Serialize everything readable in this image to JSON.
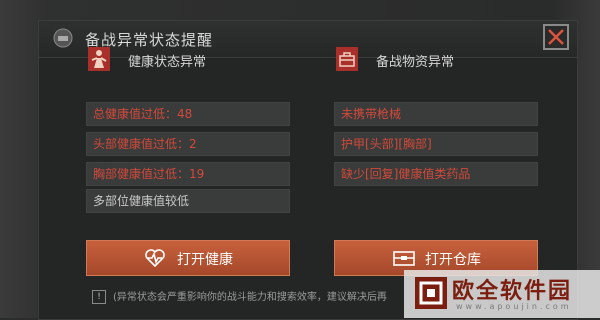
{
  "dialog": {
    "title": "备战异常状态提醒",
    "close_icon": "close-icon"
  },
  "health": {
    "header": "健康状态异常",
    "icon": "injured-soldier-icon",
    "items": [
      {
        "text": "总健康值过低：48",
        "severity": "red"
      },
      {
        "text": "头部健康值过低：2",
        "severity": "red"
      },
      {
        "text": "胸部健康值过低：19",
        "severity": "red"
      },
      {
        "text": "多部位健康值较低",
        "severity": "gray"
      }
    ],
    "button": {
      "label": "打开健康",
      "icon": "heartbeat-icon"
    }
  },
  "supplies": {
    "header": "备战物资异常",
    "icon": "supply-crate-icon",
    "items": [
      {
        "text": "未携带枪械",
        "severity": "red"
      },
      {
        "text": "护甲[头部][胸部]",
        "severity": "red"
      },
      {
        "text": "缺少[回复]健康值类药品",
        "severity": "red"
      }
    ],
    "button": {
      "label": "打开仓库",
      "icon": "storage-box-icon"
    }
  },
  "notice": {
    "icon": "info-icon",
    "text": "(异常状态会严重影响你的战斗能力和搜索效率，建议解决后再"
  },
  "watermark": {
    "name": "欧全软件园",
    "url": "www.apoujin.com"
  },
  "colors": {
    "accent": "#b5532f",
    "alert_red": "#d24a3a",
    "panel_bg": "#242626"
  }
}
